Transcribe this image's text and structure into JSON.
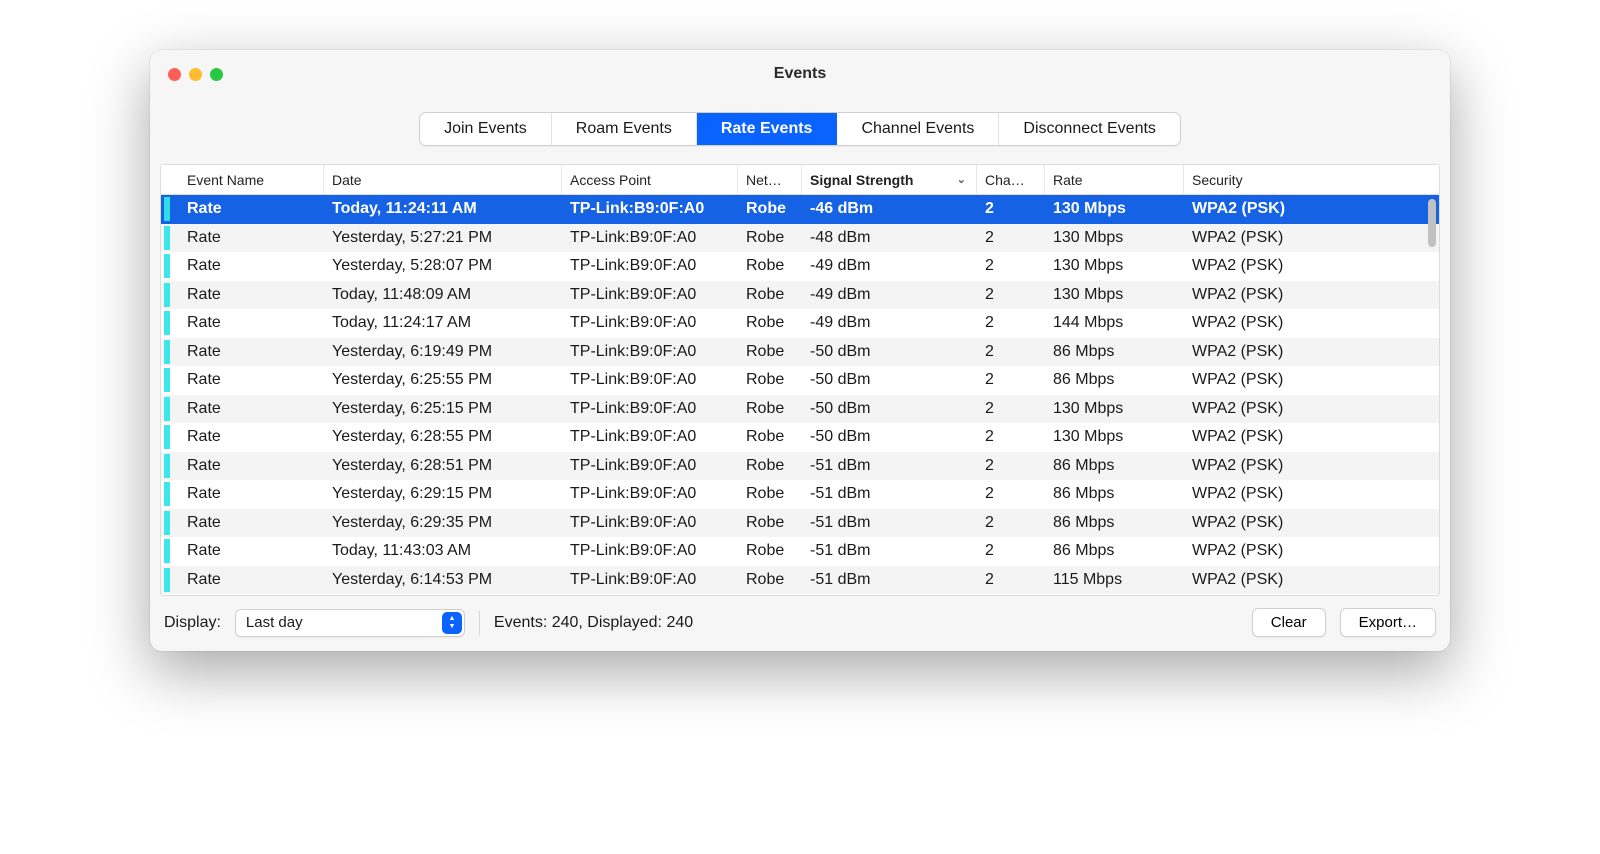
{
  "window": {
    "title": "Events"
  },
  "tabs": {
    "items": [
      "Join Events",
      "Roam Events",
      "Rate Events",
      "Channel Events",
      "Disconnect Events"
    ],
    "active_index": 2
  },
  "columns": [
    {
      "label": "Event Name",
      "cls": "col-name"
    },
    {
      "label": "Date",
      "cls": "col-date"
    },
    {
      "label": "Access Point",
      "cls": "col-ap"
    },
    {
      "label": "Net…",
      "cls": "col-net"
    },
    {
      "label": "Signal Strength",
      "cls": "col-sig",
      "sorted": true
    },
    {
      "label": "Cha…",
      "cls": "col-chan"
    },
    {
      "label": "Rate",
      "cls": "col-rate"
    },
    {
      "label": "Security",
      "cls": "col-sec"
    }
  ],
  "rows": [
    {
      "name": "Rate",
      "date": "Today, 11:24:11 AM",
      "ap": "TP-Link:B9:0F:A0",
      "net": "Robe",
      "sig": "-46 dBm",
      "chan": "2",
      "rate": "130 Mbps",
      "sec": "WPA2 (PSK)",
      "selected": true
    },
    {
      "name": "Rate",
      "date": "Yesterday, 5:27:21 PM",
      "ap": "TP-Link:B9:0F:A0",
      "net": "Robe",
      "sig": "-48 dBm",
      "chan": "2",
      "rate": "130 Mbps",
      "sec": "WPA2 (PSK)"
    },
    {
      "name": "Rate",
      "date": "Yesterday, 5:28:07 PM",
      "ap": "TP-Link:B9:0F:A0",
      "net": "Robe",
      "sig": "-49 dBm",
      "chan": "2",
      "rate": "130 Mbps",
      "sec": "WPA2 (PSK)"
    },
    {
      "name": "Rate",
      "date": "Today, 11:48:09 AM",
      "ap": "TP-Link:B9:0F:A0",
      "net": "Robe",
      "sig": "-49 dBm",
      "chan": "2",
      "rate": "130 Mbps",
      "sec": "WPA2 (PSK)"
    },
    {
      "name": "Rate",
      "date": "Today, 11:24:17 AM",
      "ap": "TP-Link:B9:0F:A0",
      "net": "Robe",
      "sig": "-49 dBm",
      "chan": "2",
      "rate": "144 Mbps",
      "sec": "WPA2 (PSK)"
    },
    {
      "name": "Rate",
      "date": "Yesterday, 6:19:49 PM",
      "ap": "TP-Link:B9:0F:A0",
      "net": "Robe",
      "sig": "-50 dBm",
      "chan": "2",
      "rate": "86 Mbps",
      "sec": "WPA2 (PSK)"
    },
    {
      "name": "Rate",
      "date": "Yesterday, 6:25:55 PM",
      "ap": "TP-Link:B9:0F:A0",
      "net": "Robe",
      "sig": "-50 dBm",
      "chan": "2",
      "rate": "86 Mbps",
      "sec": "WPA2 (PSK)"
    },
    {
      "name": "Rate",
      "date": "Yesterday, 6:25:15 PM",
      "ap": "TP-Link:B9:0F:A0",
      "net": "Robe",
      "sig": "-50 dBm",
      "chan": "2",
      "rate": "130 Mbps",
      "sec": "WPA2 (PSK)"
    },
    {
      "name": "Rate",
      "date": "Yesterday, 6:28:55 PM",
      "ap": "TP-Link:B9:0F:A0",
      "net": "Robe",
      "sig": "-50 dBm",
      "chan": "2",
      "rate": "130 Mbps",
      "sec": "WPA2 (PSK)"
    },
    {
      "name": "Rate",
      "date": "Yesterday, 6:28:51 PM",
      "ap": "TP-Link:B9:0F:A0",
      "net": "Robe",
      "sig": "-51 dBm",
      "chan": "2",
      "rate": "86 Mbps",
      "sec": "WPA2 (PSK)"
    },
    {
      "name": "Rate",
      "date": "Yesterday, 6:29:15 PM",
      "ap": "TP-Link:B9:0F:A0",
      "net": "Robe",
      "sig": "-51 dBm",
      "chan": "2",
      "rate": "86 Mbps",
      "sec": "WPA2 (PSK)"
    },
    {
      "name": "Rate",
      "date": "Yesterday, 6:29:35 PM",
      "ap": "TP-Link:B9:0F:A0",
      "net": "Robe",
      "sig": "-51 dBm",
      "chan": "2",
      "rate": "86 Mbps",
      "sec": "WPA2 (PSK)"
    },
    {
      "name": "Rate",
      "date": "Today, 11:43:03 AM",
      "ap": "TP-Link:B9:0F:A0",
      "net": "Robe",
      "sig": "-51 dBm",
      "chan": "2",
      "rate": "86 Mbps",
      "sec": "WPA2 (PSK)"
    },
    {
      "name": "Rate",
      "date": "Yesterday, 6:14:53 PM",
      "ap": "TP-Link:B9:0F:A0",
      "net": "Robe",
      "sig": "-51 dBm",
      "chan": "2",
      "rate": "115 Mbps",
      "sec": "WPA2 (PSK)"
    }
  ],
  "footer": {
    "display_label": "Display:",
    "display_value": "Last day",
    "status": "Events: 240, Displayed: 240",
    "clear": "Clear",
    "export": "Export…"
  }
}
